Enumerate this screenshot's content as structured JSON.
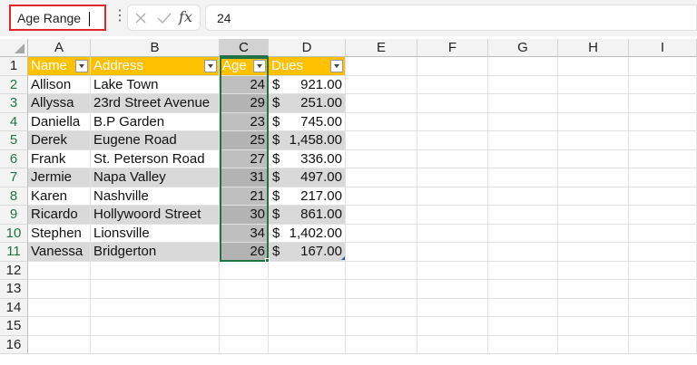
{
  "formula_bar": {
    "name_box": "Age Range",
    "more_icon": "⋮",
    "fx_label": "fx",
    "formula_value": "24"
  },
  "columns": [
    "A",
    "B",
    "C",
    "D",
    "E",
    "F",
    "G",
    "H",
    "I"
  ],
  "selected_column": "C",
  "rows": [
    "1",
    "2",
    "3",
    "4",
    "5",
    "6",
    "7",
    "8",
    "9",
    "10",
    "11",
    "12",
    "13",
    "14",
    "15",
    "16"
  ],
  "table": {
    "headers": [
      "Name",
      "Address",
      "Age",
      "Dues"
    ],
    "currency_symbol": "$",
    "records": [
      {
        "name": "Allison",
        "address": "Lake Town",
        "age": "24",
        "dues": "921.00"
      },
      {
        "name": "Allyssa",
        "address": "23rd Street Avenue",
        "age": "29",
        "dues": "251.00"
      },
      {
        "name": "Daniella",
        "address": "B.P Garden",
        "age": "23",
        "dues": "745.00"
      },
      {
        "name": "Derek",
        "address": "Eugene Road",
        "age": "25",
        "dues": "1,458.00"
      },
      {
        "name": "Frank",
        "address": "St. Peterson Road",
        "age": "27",
        "dues": "336.00"
      },
      {
        "name": "Jermie",
        "address": "Napa Valley",
        "age": "31",
        "dues": "497.00"
      },
      {
        "name": "Karen",
        "address": "Nashville",
        "age": "21",
        "dues": "217.00"
      },
      {
        "name": "Ricardo",
        "address": "Hollywoord Street",
        "age": "30",
        "dues": "861.00"
      },
      {
        "name": "Stephen",
        "address": "Lionsville",
        "age": "34",
        "dues": "1,402.00"
      },
      {
        "name": "Vanessa",
        "address": "Bridgerton",
        "age": "26",
        "dues": "167.00"
      }
    ]
  },
  "colors": {
    "header_fill": "#ffc000",
    "band_fill": "#d9d9d9",
    "selection_border": "#217346",
    "name_box_highlight": "#e0262c"
  }
}
